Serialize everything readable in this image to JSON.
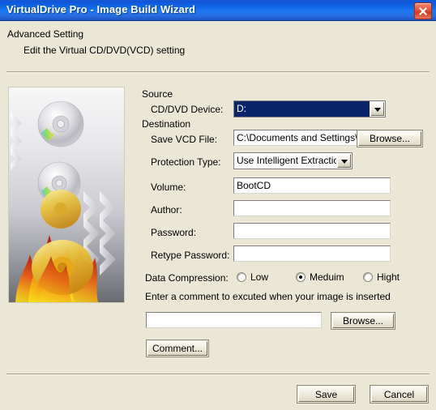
{
  "window": {
    "title": "VirtualDrive Pro - Image Build Wizard",
    "close_icon": "close-icon"
  },
  "header": {
    "title": "Advanced Setting",
    "subtitle": "Edit the Virtual CD/DVD(VCD) setting"
  },
  "artwork": {
    "alt": "cd-dvd-burning-flames-illustration"
  },
  "form": {
    "source_group_label": "Source",
    "destination_group_label": "Destination",
    "cd_dvd_device": {
      "label": "CD/DVD Device:",
      "value": "D:",
      "arrow_icon": "chevron-down-icon"
    },
    "save_vcd_file": {
      "label": "Save VCD File:",
      "value": "C:\\Documents and Settings\\",
      "placeholder": "",
      "browse_label": "Browse..."
    },
    "protection_type": {
      "label": "Protection Type:",
      "value": "Use Intelligent Extraction",
      "arrow_icon": "chevron-down-icon"
    },
    "volume": {
      "label": "Volume:",
      "value": "BootCD",
      "placeholder": ""
    },
    "author": {
      "label": "Author:",
      "value": "",
      "placeholder": ""
    },
    "password": {
      "label": "Password:",
      "value": "",
      "placeholder": ""
    },
    "retype_password": {
      "label": "Retype Password:",
      "value": "",
      "placeholder": ""
    },
    "data_compression": {
      "label": "Data Compression:",
      "options": [
        {
          "label": "Low",
          "selected": false
        },
        {
          "label": "Meduim",
          "selected": true
        },
        {
          "label": "Hight",
          "selected": false
        }
      ]
    },
    "comment_section": {
      "hint": "Enter a comment to excuted when your image is inserted",
      "value": "",
      "placeholder": "",
      "browse_label": "Browse...",
      "comment_button_label": "Comment..."
    }
  },
  "footer": {
    "save_label": "Save",
    "cancel_label": "Cancel"
  },
  "colors": {
    "dialog_background": "#eae7d7",
    "titlebar_blue": "#0f6ae8",
    "close_red": "#cf3c20",
    "selection_blue": "#0a246a"
  }
}
